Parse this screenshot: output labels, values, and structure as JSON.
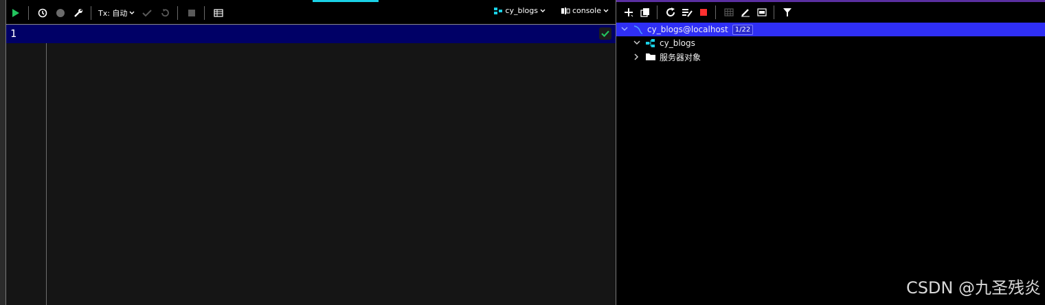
{
  "editor": {
    "toolbar": {
      "run": "run-icon",
      "history": "history-icon",
      "record": "record-icon",
      "settings": "wrench-icon",
      "tx_mode": "Tx: 自动",
      "commit": "commit-icon",
      "rollback": "rollback-icon",
      "stop": "stop-icon",
      "table": "table-icon",
      "schema_selector": "cy_blogs",
      "session_selector": "console"
    },
    "lines": [
      "1"
    ],
    "colors": {
      "current_line": "#000066",
      "run": "#22c55e",
      "tab_accent": "#1ad1e6"
    }
  },
  "database": {
    "toolbar": [
      "add-icon",
      "copy-icon",
      "refresh-icon",
      "schema-icon",
      "stop-icon",
      "table-icon",
      "edit-icon",
      "sql-icon",
      "filter-icon"
    ],
    "tree": {
      "root": {
        "label": "cy_blogs@localhost",
        "badge": "1/22"
      },
      "children": [
        {
          "label": "cy_blogs",
          "icon": "schema-icon"
        },
        {
          "label": "服务器对象",
          "icon": "folder-icon"
        }
      ]
    },
    "colors": {
      "selected_row": "#2f2ff5",
      "stop": "#ff3030"
    }
  },
  "watermark": "CSDN @九圣残炎"
}
